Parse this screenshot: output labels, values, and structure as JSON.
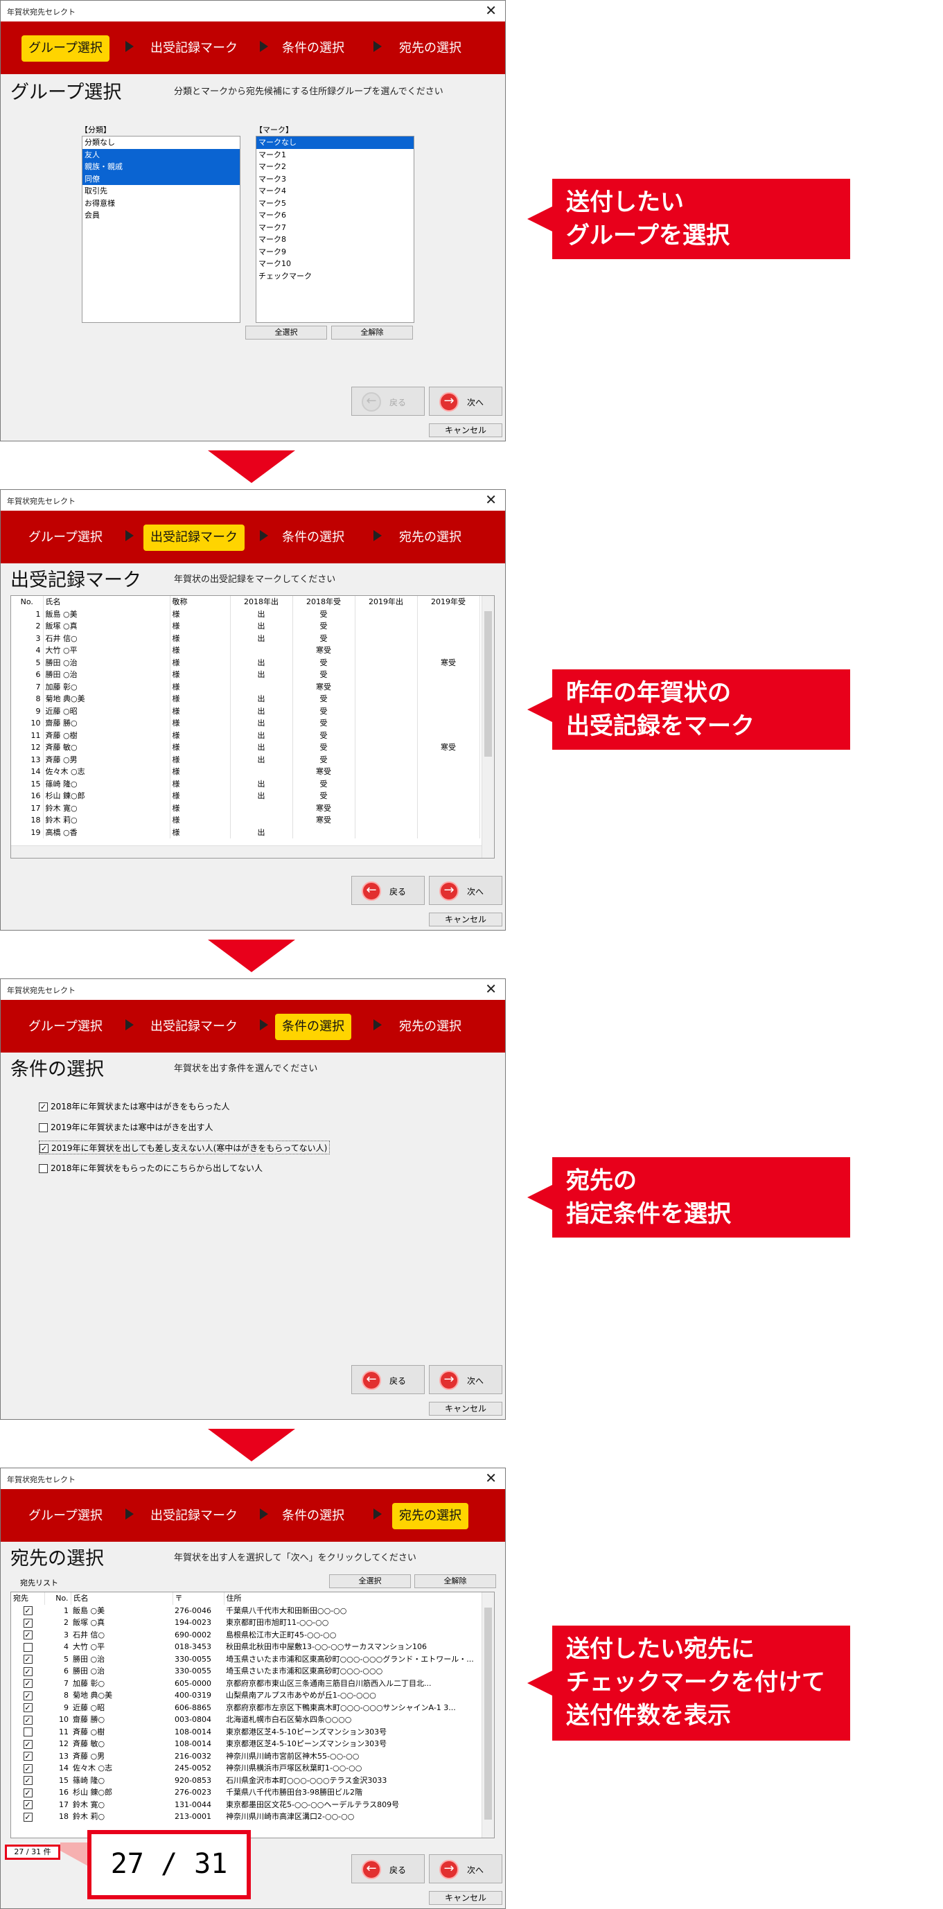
{
  "app_title": "年賀状宛先セレクト",
  "steps": [
    "グループ選択",
    "出受記録マーク",
    "条件の選択",
    "宛先の選択"
  ],
  "buttons": {
    "back": "戻る",
    "next": "次へ",
    "cancel": "キャンセル",
    "select_all": "全選択",
    "deselect_all": "全解除"
  },
  "screen1": {
    "title": "グループ選択",
    "desc": "分類とマークから宛先候補にする住所録グループを選んでください",
    "class_label": "【分類】",
    "classes": [
      "分類なし",
      "友人",
      "親族・親戚",
      "同僚",
      "取引先",
      "お得意様",
      "会員"
    ],
    "class_selected": [
      1,
      2,
      3
    ],
    "mark_label": "【マーク】",
    "marks": [
      "マークなし",
      "マーク1",
      "マーク2",
      "マーク3",
      "マーク4",
      "マーク5",
      "マーク6",
      "マーク7",
      "マーク8",
      "マーク9",
      "マーク10",
      "チェックマーク"
    ],
    "mark_selected": [
      0
    ]
  },
  "screen2": {
    "title": "出受記録マーク",
    "desc": "年賀状の出受記録をマークしてください",
    "headers": [
      "No.",
      "氏名",
      "敬称",
      "2018年出",
      "2018年受",
      "2019年出",
      "2019年受"
    ],
    "rows": [
      [
        "1",
        "飯島 ○美",
        "様",
        "出",
        "受",
        "",
        ""
      ],
      [
        "2",
        "飯塚 ○真",
        "様",
        "出",
        "受",
        "",
        ""
      ],
      [
        "3",
        "石井 信○",
        "様",
        "出",
        "受",
        "",
        ""
      ],
      [
        "4",
        "大竹 ○平",
        "様",
        "",
        "寒受",
        "",
        ""
      ],
      [
        "5",
        "勝田 ○治",
        "様",
        "出",
        "受",
        "",
        "寒受"
      ],
      [
        "6",
        "勝田 ○治",
        "様",
        "出",
        "受",
        "",
        ""
      ],
      [
        "7",
        "加藤 彰○",
        "様",
        "",
        "寒受",
        "",
        ""
      ],
      [
        "8",
        "菊地 典○美",
        "様",
        "出",
        "受",
        "",
        ""
      ],
      [
        "9",
        "近藤 ○昭",
        "様",
        "出",
        "受",
        "",
        ""
      ],
      [
        "10",
        "齋藤 勝○",
        "様",
        "出",
        "受",
        "",
        ""
      ],
      [
        "11",
        "斉藤 ○樹",
        "様",
        "出",
        "受",
        "",
        ""
      ],
      [
        "12",
        "斉藤 敏○",
        "様",
        "出",
        "受",
        "",
        "寒受"
      ],
      [
        "13",
        "斉藤 ○男",
        "様",
        "出",
        "受",
        "",
        ""
      ],
      [
        "14",
        "佐々木 ○志",
        "様",
        "",
        "寒受",
        "",
        ""
      ],
      [
        "15",
        "篠崎 隆○",
        "様",
        "出",
        "受",
        "",
        ""
      ],
      [
        "16",
        "杉山 錬○郎",
        "様",
        "出",
        "受",
        "",
        ""
      ],
      [
        "17",
        "鈴木 寛○",
        "様",
        "",
        "寒受",
        "",
        ""
      ],
      [
        "18",
        "鈴木 莉○",
        "様",
        "",
        "寒受",
        "",
        ""
      ],
      [
        "19",
        "高橋 ○香",
        "様",
        "出",
        "",
        "",
        ""
      ]
    ]
  },
  "screen3": {
    "title": "条件の選択",
    "desc": "年賀状を出す条件を選んでください",
    "conditions": [
      {
        "label": "2018年に年賀状または寒中はがきをもらった人",
        "checked": true
      },
      {
        "label": "2019年に年賀状または寒中はがきを出す人",
        "checked": false
      },
      {
        "label": "2019年に年賀状を出しても差し支えない人(寒中はがきをもらってない人)",
        "checked": true
      },
      {
        "label": "2018年に年賀状をもらったのにこちらから出してない人",
        "checked": false
      }
    ]
  },
  "screen4": {
    "title": "宛先の選択",
    "desc": "年賀状を出す人を選択して「次へ」をクリックしてください",
    "list_label": "宛先リスト",
    "headers": [
      "宛先",
      "No.",
      "氏名",
      "〒",
      "住所"
    ],
    "rows": [
      [
        true,
        "1",
        "飯島 ○美",
        "276-0046",
        "千葉県八千代市大和田新田○○-○○"
      ],
      [
        true,
        "2",
        "飯塚 ○真",
        "194-0023",
        "東京都町田市旭町11-○○-○○"
      ],
      [
        true,
        "3",
        "石井 信○",
        "690-0002",
        "島根県松江市大正町45-○○-○○"
      ],
      [
        false,
        "4",
        "大竹 ○平",
        "018-3453",
        "秋田県北秋田市中屋敷13-○○-○○サーカスマンション106"
      ],
      [
        true,
        "5",
        "勝田 ○治",
        "330-0055",
        "埼玉県さいたま市浦和区東高砂町○○○-○○○グランド・エトワール・..."
      ],
      [
        true,
        "6",
        "勝田 ○治",
        "330-0055",
        "埼玉県さいたま市浦和区東高砂町○○○-○○○"
      ],
      [
        true,
        "7",
        "加藤 彰○",
        "605-0000",
        "京都府京都市東山区三条通南三筋目白川筋西入ル二丁目北..."
      ],
      [
        true,
        "8",
        "菊地 典○美",
        "400-0319",
        "山梨県南アルプス市あやめが丘1-○○-○○○"
      ],
      [
        true,
        "9",
        "近藤 ○昭",
        "606-8865",
        "京都府京都市左京区下鴨東高木町○○○-○○○サンシャインA-1 3..."
      ],
      [
        true,
        "10",
        "齋藤 勝○",
        "003-0804",
        "北海道札幌市白石区菊水四条○○○○"
      ],
      [
        false,
        "11",
        "斉藤 ○樹",
        "108-0014",
        "東京都港区芝4-5-10ピーンズマンション303号"
      ],
      [
        true,
        "12",
        "斉藤 敏○",
        "108-0014",
        "東京都港区芝4-5-10ピーンズマンション303号"
      ],
      [
        true,
        "13",
        "斉藤 ○男",
        "216-0032",
        "神奈川県川崎市宮前区神木55-○○-○○"
      ],
      [
        true,
        "14",
        "佐々木 ○志",
        "245-0052",
        "神奈川県横浜市戸塚区秋葉町1-○○-○○"
      ],
      [
        true,
        "15",
        "篠崎 隆○",
        "920-0853",
        "石川県金沢市本町○○○-○○○テラス金沢3033"
      ],
      [
        true,
        "16",
        "杉山 錬○郎",
        "276-0023",
        "千葉県八千代市勝田台3-98勝田ビル2階"
      ],
      [
        true,
        "17",
        "鈴木 寛○",
        "131-0044",
        "東京都墨田区文花5-○○-○○ヘーデルテラス809号"
      ],
      [
        true,
        "18",
        "鈴木 莉○",
        "213-0001",
        "神奈川県川崎市高津区溝口2-○○-○○"
      ]
    ],
    "count_small": "27 / 31 件",
    "count_big": "27 / 31 件"
  },
  "callouts": [
    [
      "送付したい",
      "グループを選択"
    ],
    [
      "昨年の年賀状の",
      "出受記録をマーク"
    ],
    [
      "宛先の",
      "指定条件を選択"
    ],
    [
      "送付したい宛先に",
      "チェックマークを付けて",
      "送付件数を表示"
    ]
  ]
}
